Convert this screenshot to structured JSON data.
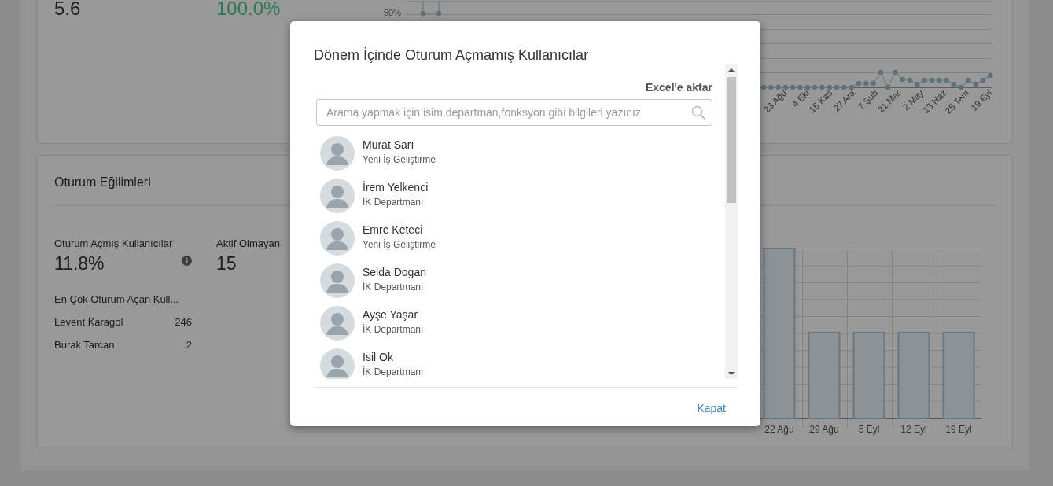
{
  "summary": {
    "metrics": [
      {
        "value": "5.6",
        "kind": "neutral"
      },
      {
        "value": "100.0%",
        "kind": "positive"
      }
    ]
  },
  "activity_chart": {
    "y_tick": "50%",
    "x_labels": [
      "23 Ağu",
      "4 Eki",
      "15 Kas",
      "27 Ara",
      "7 Şub",
      "21 Mar",
      "2 May",
      "13 Haz",
      "25 Tem",
      "19 Eyl"
    ]
  },
  "trends": {
    "title": "Oturum Eğilimleri",
    "stats": [
      {
        "label": "Oturum Açmış Kullanıcılar",
        "value": "11.8%",
        "info": true
      },
      {
        "label": "Aktif Olmayan",
        "value": "15"
      }
    ],
    "top_users": {
      "title": "En Çok Oturum Açan Kull...",
      "rows": [
        {
          "name": "Levent Karagol",
          "count": "246"
        },
        {
          "name": "Burak Tarcan",
          "count": "2"
        }
      ]
    },
    "bar_chart": {
      "x_labels": [
        "22 Ağu",
        "29 Ağu",
        "5 Eyl",
        "12 Eyl",
        "19 Eyl"
      ]
    }
  },
  "modal": {
    "title": "Dönem İçinde Oturum Açmamış Kullanıcılar",
    "export_link": "Excel'e aktar",
    "search": {
      "placeholder": "Arama yapmak için isim,departman,fonksyon gibi bilgileri yazınız"
    },
    "users": [
      {
        "name": "Murat Sarı",
        "department": "Yeni İş Geliştirme"
      },
      {
        "name": "İrem Yelkenci",
        "department": "İK Departmanı"
      },
      {
        "name": "Emre Keteci",
        "department": "Yeni İş Geliştirme"
      },
      {
        "name": "Selda Dogan",
        "department": "İK Departmanı"
      },
      {
        "name": "Ayşe Yaşar",
        "department": "İK Departmanı"
      },
      {
        "name": "Isil Ok",
        "department": "İK Departmanı"
      }
    ],
    "close_button": "Kapat"
  }
}
